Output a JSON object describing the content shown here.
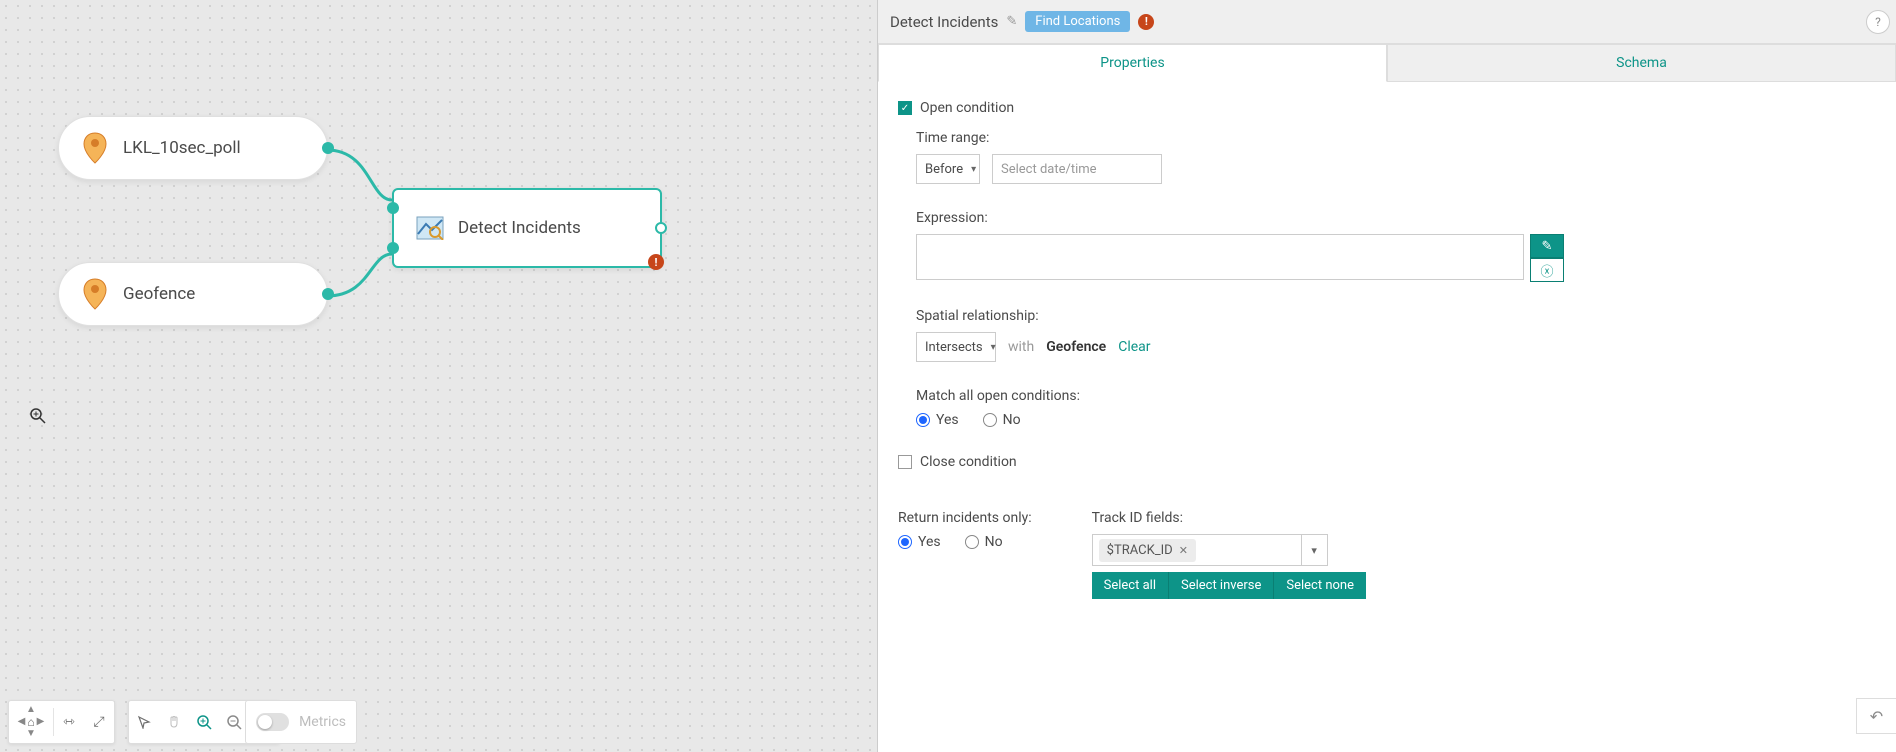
{
  "canvas": {
    "node1_label": "LKL_10sec_poll",
    "node2_label": "Geofence",
    "detect_label": "Detect Incidents",
    "metrics_label": "Metrics"
  },
  "panel": {
    "title": "Detect Incidents",
    "chip": "Find Locations",
    "tab_properties": "Properties",
    "tab_schema": "Schema",
    "open_condition_label": "Open condition",
    "time_range_label": "Time range:",
    "time_range_select": "Before",
    "time_range_placeholder": "Select date/time",
    "expression_label": "Expression:",
    "spatial_label": "Spatial relationship:",
    "spatial_select": "Intersects",
    "spatial_with": "with",
    "spatial_layer": "Geofence",
    "spatial_clear": "Clear",
    "match_label": "Match all open conditions:",
    "yes": "Yes",
    "no": "No",
    "close_condition_label": "Close condition",
    "return_label": "Return incidents only:",
    "track_label": "Track ID fields:",
    "track_chip": "$TRACK_ID",
    "select_all": "Select all",
    "select_inverse": "Select inverse",
    "select_none": "Select none"
  }
}
